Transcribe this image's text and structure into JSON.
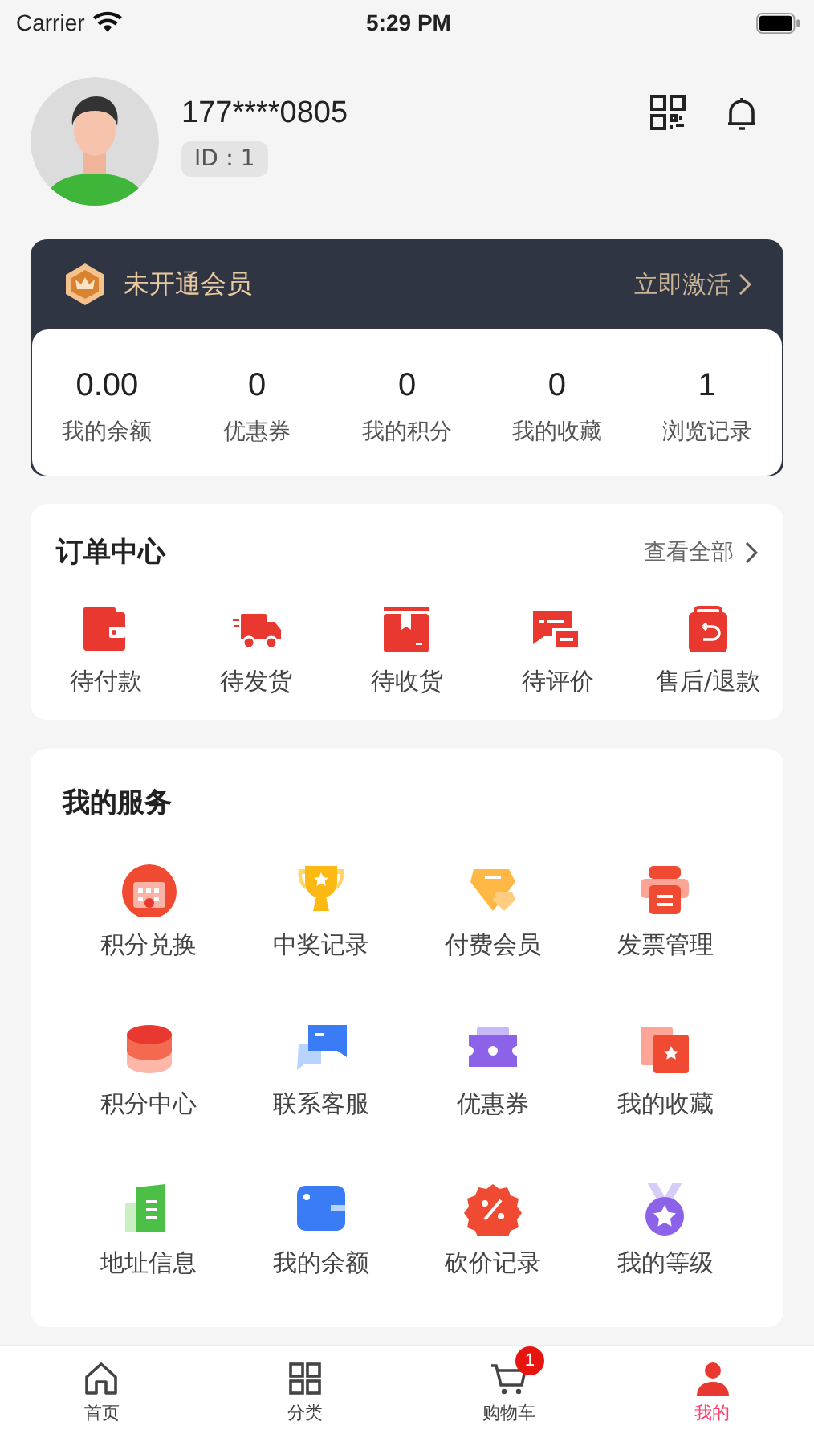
{
  "status_bar": {
    "carrier": "Carrier",
    "time": "5:29 PM"
  },
  "profile": {
    "phone": "177****0805",
    "id_label": "ID：1"
  },
  "membership": {
    "title": "未开通会员",
    "action": "立即激活"
  },
  "stats": [
    {
      "value": "0.00",
      "label": "我的余额"
    },
    {
      "value": "0",
      "label": "优惠券"
    },
    {
      "value": "0",
      "label": "我的积分"
    },
    {
      "value": "0",
      "label": "我的收藏"
    },
    {
      "value": "1",
      "label": "浏览记录"
    }
  ],
  "orders": {
    "title": "订单中心",
    "view_all": "查看全部",
    "items": [
      {
        "label": "待付款"
      },
      {
        "label": "待发货"
      },
      {
        "label": "待收货"
      },
      {
        "label": "待评价"
      },
      {
        "label": "售后/退款"
      }
    ]
  },
  "services": {
    "title": "我的服务",
    "items": [
      {
        "label": "积分兑换"
      },
      {
        "label": "中奖记录"
      },
      {
        "label": "付费会员"
      },
      {
        "label": "发票管理"
      },
      {
        "label": "积分中心"
      },
      {
        "label": "联系客服"
      },
      {
        "label": "优惠券"
      },
      {
        "label": "我的收藏"
      },
      {
        "label": "地址信息"
      },
      {
        "label": "我的余额"
      },
      {
        "label": "砍价记录"
      },
      {
        "label": "我的等级"
      }
    ]
  },
  "tab_bar": [
    {
      "label": "首页",
      "selected": false
    },
    {
      "label": "分类",
      "selected": false
    },
    {
      "label": "购物车",
      "selected": false,
      "badge": "1"
    },
    {
      "label": "我的",
      "selected": true
    }
  ]
}
